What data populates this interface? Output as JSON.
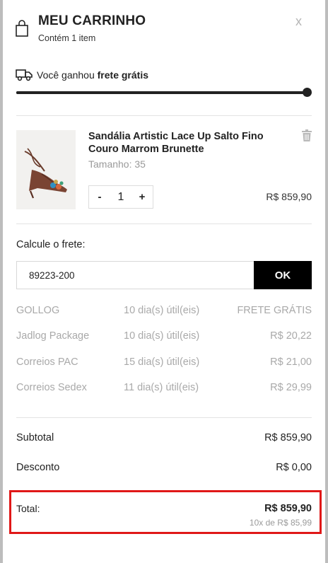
{
  "cart": {
    "title": "MEU CARRINHO",
    "subtitle": "Contém 1 item",
    "close_label": "x"
  },
  "shipping_banner": {
    "prefix": "Você ganhou ",
    "highlight": "frete grátis",
    "progress": 1.0
  },
  "item": {
    "name": "Sandália Artistic Lace Up Salto Fino Couro Marrom Brunette",
    "size": "Tamanho: 35",
    "quantity": "1",
    "minus": "-",
    "plus": "+",
    "price": "R$ 859,90"
  },
  "freight": {
    "label": "Calcule o frete:",
    "cep_value": "89223-200",
    "ok_label": "OK",
    "options": [
      {
        "carrier": "GOLLOG",
        "days": "10 dia(s) útil(eis)",
        "price": "FRETE GRÁTIS"
      },
      {
        "carrier": "Jadlog Package",
        "days": "10 dia(s) útil(eis)",
        "price": "R$ 20,22"
      },
      {
        "carrier": "Correios PAC",
        "days": "15 dia(s) útil(eis)",
        "price": "R$ 21,00"
      },
      {
        "carrier": "Correios Sedex",
        "days": "11 dia(s) útil(eis)",
        "price": "R$ 29,99"
      }
    ]
  },
  "summary": {
    "subtotal_label": "Subtotal",
    "subtotal_value": "R$ 859,90",
    "discount_label": "Desconto",
    "discount_value": "R$ 0,00",
    "total_label": "Total:",
    "total_value": "R$ 859,90",
    "installments": "10x de R$ 85,99"
  },
  "colors": {
    "accent": "#000000",
    "highlight_box": "#e01818",
    "muted": "#a9a9a9"
  },
  "icons": {
    "bag": "shopping-bag-icon",
    "truck": "truck-icon",
    "trash": "trash-icon",
    "close": "close-icon"
  }
}
